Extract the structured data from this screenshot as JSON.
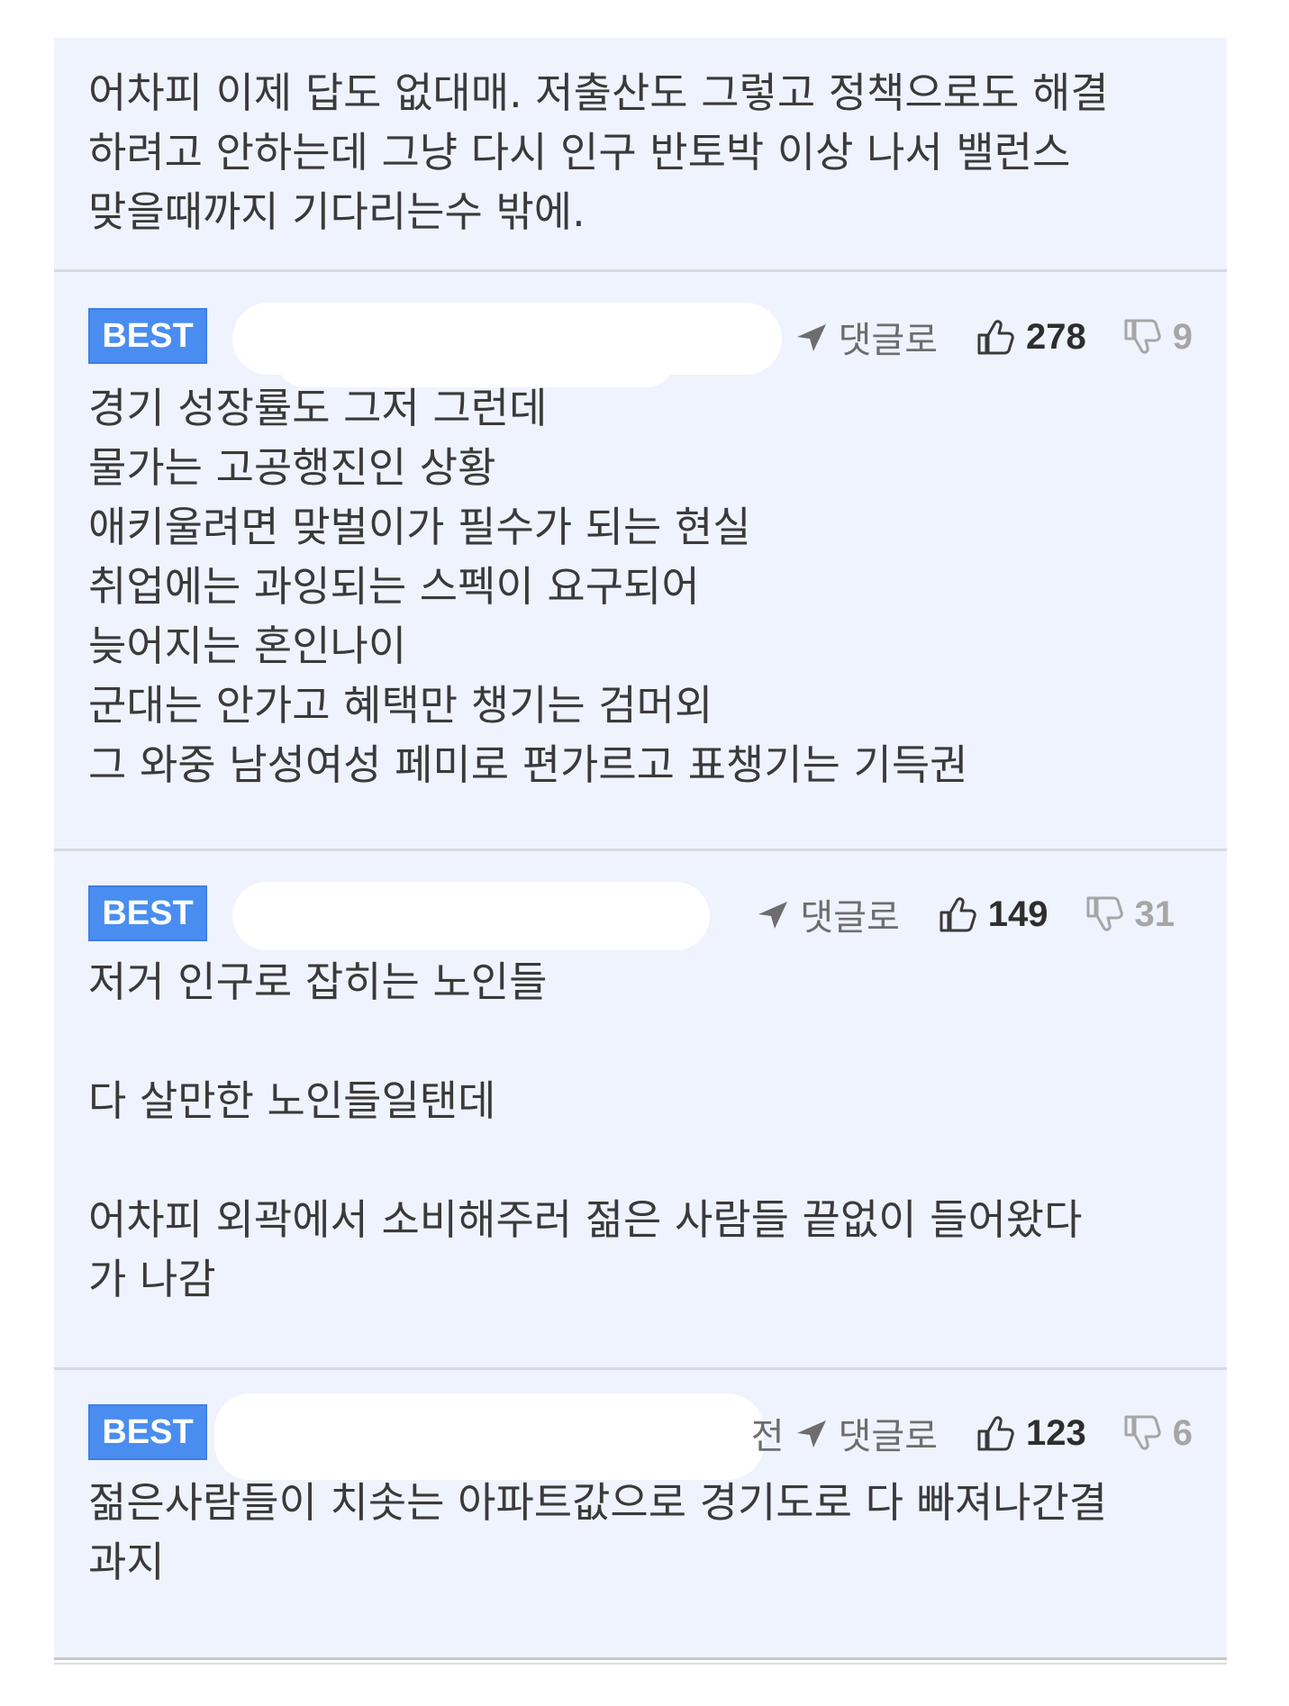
{
  "top_comment": {
    "text": "어차피 이제 답도 없대매. 저출산도 그렇고 정책으로도 해결\n하려고 안하는데 그냥 다시 인구 반토박 이상 나서 밸런스\n맞을때까지 기다리는수 밖에."
  },
  "comments": [
    {
      "badge": "BEST",
      "reply_label": "댓글로",
      "likes": "278",
      "dislikes": "9",
      "text": "경기 성장률도 그저 그런데\n물가는 고공행진인 상황\n애키울려면 맞벌이가 필수가 되는 현실\n취업에는 과잉되는 스펙이 요구되어\n늦어지는 혼인나이\n군대는 안가고 혜택만 챙기는 검머외\n그 와중 남성여성 페미로 편가르고 표챙기는 기득권"
    },
    {
      "badge": "BEST",
      "reply_label": "댓글로",
      "likes": "149",
      "dislikes": "31",
      "text": "저거 인구로 잡히는 노인들\n\n다 살만한 노인들일탠데\n\n어차피 외곽에서 소비해주러 젊은 사람들 끝없이 들어왔다\n가 나감"
    },
    {
      "badge": "BEST",
      "time_fragment": "전",
      "reply_label": "댓글로",
      "likes": "123",
      "dislikes": "6",
      "text": "젊은사람들이 치솟는 아파트값으로 경기도로 다 빠져나간결\n과지"
    }
  ],
  "colors": {
    "panel_bg": "#eff3fd",
    "badge_bg": "#4a8df0",
    "text": "#3a3a3a",
    "muted": "#6d6d6d"
  },
  "icons": [
    "reply-arrow-icon",
    "thumbs-up-icon",
    "thumbs-down-icon"
  ]
}
